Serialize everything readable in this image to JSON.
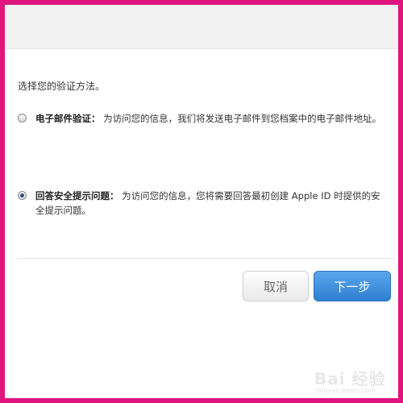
{
  "prompt": "选择您的验证方法。",
  "options": [
    {
      "title": "电子邮件验证：",
      "description": "为访问您的信息，我们将发送电子邮件到您档案中的电子邮件地址。",
      "checked": false
    },
    {
      "title": "回答安全提示问题：",
      "description": "为访问您的信息，您将需要回答最初创建 Apple ID 时提供的安全提示问题。",
      "checked": true
    }
  ],
  "buttons": {
    "cancel_label": "取消",
    "next_label": "下一步"
  },
  "watermark": {
    "text": "Bai 经验",
    "sub": "jingyan.baidu.com"
  }
}
